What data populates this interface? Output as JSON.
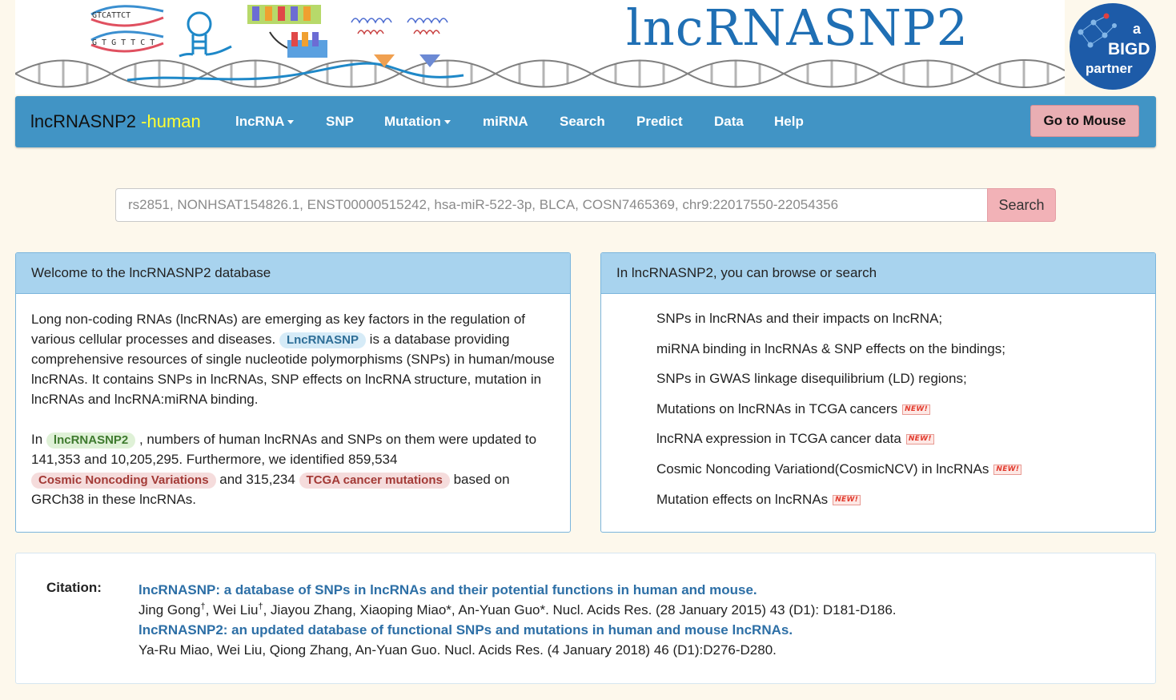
{
  "banner": {
    "site_title": "lncRNASNP2",
    "seq_top": "GTCATTCT",
    "seq_bottom": "G T G T T C T",
    "partner_a": "a",
    "partner_bigd": "BIGD",
    "partner_word": "partner"
  },
  "nav": {
    "brand": "lncRNASNP2",
    "brand_sub": " -human",
    "items": [
      {
        "label": "lncRNA",
        "dropdown": true
      },
      {
        "label": "SNP",
        "dropdown": false
      },
      {
        "label": "Mutation",
        "dropdown": true
      },
      {
        "label": "miRNA",
        "dropdown": false
      },
      {
        "label": "Search",
        "dropdown": false
      },
      {
        "label": "Predict",
        "dropdown": false
      },
      {
        "label": "Data",
        "dropdown": false
      },
      {
        "label": "Help",
        "dropdown": false
      }
    ],
    "mouse_button": "Go to Mouse"
  },
  "search": {
    "placeholder": "rs2851, NONHSAT154826.1, ENST00000515242, hsa-miR-522-3p, BLCA, COSN7465369, chr9:22017550-22054356",
    "button": "Search"
  },
  "welcome": {
    "heading": "Welcome to the lncRNASNP2 database",
    "p1_a": "Long non-coding RNAs (lncRNAs) are emerging as key factors in the regulation of various cellular processes and diseases. ",
    "tag_lncrnasnp": "LncRNASNP",
    "p1_b": " is a database providing comprehensive resources of single nucleotide polymorphisms (SNPs) in human/mouse lncRNAs. It contains SNPs in lncRNAs, SNP effects on lncRNA structure, mutation in lncRNAs and lncRNA:miRNA binding.",
    "p2_a": "In ",
    "tag_lncrnasnp2": "lncRNASNP2",
    "p2_b": " , numbers of human lncRNAs and SNPs on them were updated to 141,353 and 10,205,295. Furthermore, we identified 859,534 ",
    "tag_cosmic": "Cosmic Noncoding Variations",
    "p2_c": " and 315,234 ",
    "tag_tcga": "TCGA cancer mutations",
    "p2_d": " based on GRCh38 in these lncRNAs."
  },
  "browse": {
    "heading": "In lncRNASNP2, you can browse or search",
    "new_label": "NEW!",
    "items": [
      {
        "text": "SNPs in lncRNAs and their impacts on lncRNA;",
        "new": false
      },
      {
        "text": "miRNA binding in lncRNAs & SNP effects on the bindings;",
        "new": false
      },
      {
        "text": "SNPs in GWAS linkage disequilibrium (LD) regions;",
        "new": false
      },
      {
        "text": "Mutations on lncRNAs in TCGA cancers",
        "new": true
      },
      {
        "text": "lncRNA expression in TCGA cancer data",
        "new": true
      },
      {
        "text": "Cosmic Noncoding Variationd(CosmicNCV) in lncRNAs",
        "new": true
      },
      {
        "text": "Mutation effects on lncRNAs",
        "new": true
      }
    ]
  },
  "citation": {
    "label": "Citation:",
    "ref1_title": "lncRNASNP: a database of SNPs in lncRNAs and their potential functions in human and mouse.",
    "ref1_author1": "Jing Gong",
    "ref1_dagger1": "†",
    "ref1_author2": ", Wei Liu",
    "ref1_dagger2": "†",
    "ref1_rest": ", Jiayou Zhang, Xiaoping Miao*, An-Yuan Guo*. Nucl. Acids Res. (28 January 2015) 43 (D1): D181-D186.",
    "ref2_title": "lncRNASNP2: an updated database of functional SNPs and mutations in human and mouse lncRNAs.",
    "ref2_authors": "Ya-Ru Miao, Wei Liu, Qiong Zhang, An-Yuan Guo. Nucl. Acids Res. (4 January 2018) 46 (D1):D276-D280."
  }
}
